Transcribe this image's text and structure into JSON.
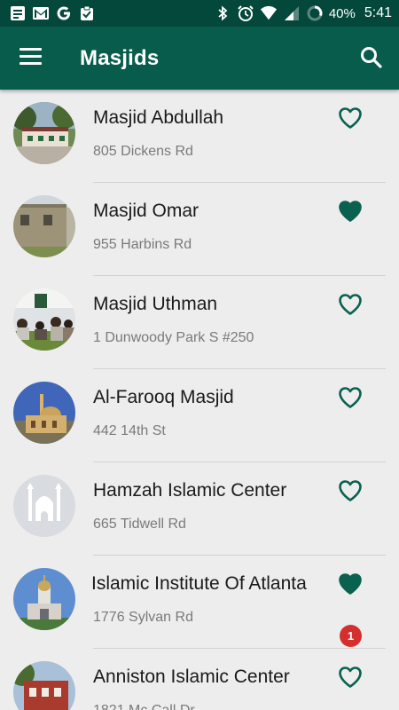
{
  "status_bar": {
    "notification_icons": [
      "document-icon",
      "gmail-icon",
      "google-icon",
      "clipboard-check-icon"
    ],
    "system_icons": [
      "bluetooth-icon",
      "alarm-icon",
      "wifi-icon",
      "cell-signal-icon",
      "battery-ring-icon"
    ],
    "battery": "40%",
    "time": "5:41"
  },
  "app_bar": {
    "title": "Masjids",
    "color": "#085c4c",
    "status_color": "#04473b"
  },
  "masjids": [
    {
      "name": "Masjid Abdullah",
      "address": "805 Dickens Rd",
      "favorite": false
    },
    {
      "name": "Masjid Omar",
      "address": "955 Harbins Rd",
      "favorite": true
    },
    {
      "name": "Masjid Uthman",
      "address": "1 Dunwoody Park S #250",
      "favorite": false
    },
    {
      "name": "Al-Farooq Masjid",
      "address": "442 14th St",
      "favorite": false
    },
    {
      "name": "Hamzah Islamic Center",
      "address": "665 Tidwell Rd",
      "favorite": false
    },
    {
      "name": "Islamic Institute Of Atlanta",
      "address": "1776 Sylvan Rd",
      "favorite": true,
      "badge": "1"
    },
    {
      "name": "Anniston Islamic Center",
      "address": "1821 Mc Call Dr",
      "favorite": false
    }
  ],
  "accent_color": "#0a6150",
  "badge_color": "#d32f2f"
}
